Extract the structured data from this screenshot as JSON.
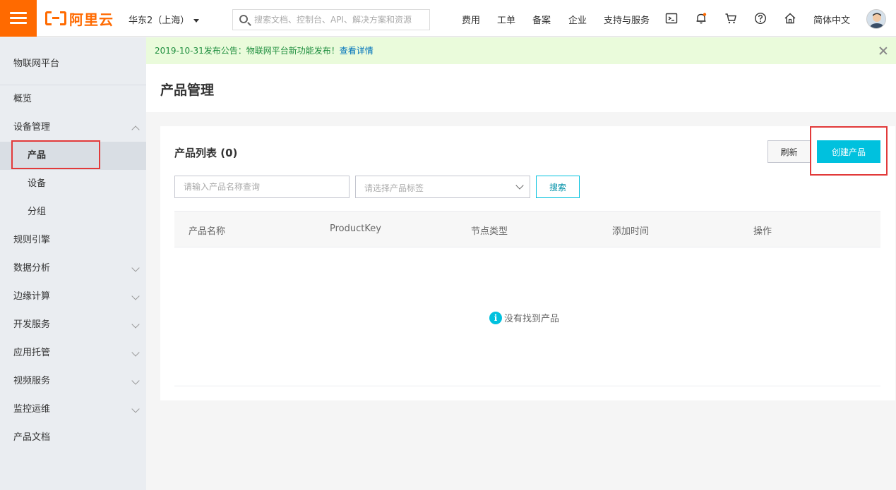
{
  "topbar": {
    "logo_text": "阿里云",
    "region": "华东2（上海）",
    "search_placeholder": "搜索文档、控制台、API、解决方案和资源",
    "links": [
      "费用",
      "工单",
      "备案",
      "企业",
      "支持与服务"
    ],
    "language": "简体中文",
    "notification_dot_color": "#ff6a00"
  },
  "sidebar": {
    "title": "物联网平台",
    "items": [
      {
        "label": "概览"
      },
      {
        "label": "设备管理"
      },
      {
        "label": "产品"
      },
      {
        "label": "设备"
      },
      {
        "label": "分组"
      },
      {
        "label": "规则引擎"
      },
      {
        "label": "数据分析"
      },
      {
        "label": "边缘计算"
      },
      {
        "label": "开发服务"
      },
      {
        "label": "应用托管"
      },
      {
        "label": "视频服务"
      },
      {
        "label": "监控运维"
      },
      {
        "label": "产品文档"
      }
    ]
  },
  "notice": {
    "text": "2019-10-31发布公告：物联网平台新功能发布！",
    "link": "查看详情"
  },
  "page": {
    "title": "产品管理"
  },
  "product_list": {
    "title": "产品列表 (0)",
    "refresh_label": "刷新",
    "create_label": "创建产品",
    "name_placeholder": "请输入产品名称查询",
    "tag_placeholder": "请选择产品标签",
    "search_label": "搜索",
    "columns": [
      "产品名称",
      "ProductKey",
      "节点类型",
      "添加时间",
      "操作"
    ],
    "empty_text": "没有找到产品"
  },
  "colors": {
    "brand": "#ff6a00",
    "primary": "#00c1de",
    "highlight": "#e23a3a"
  }
}
